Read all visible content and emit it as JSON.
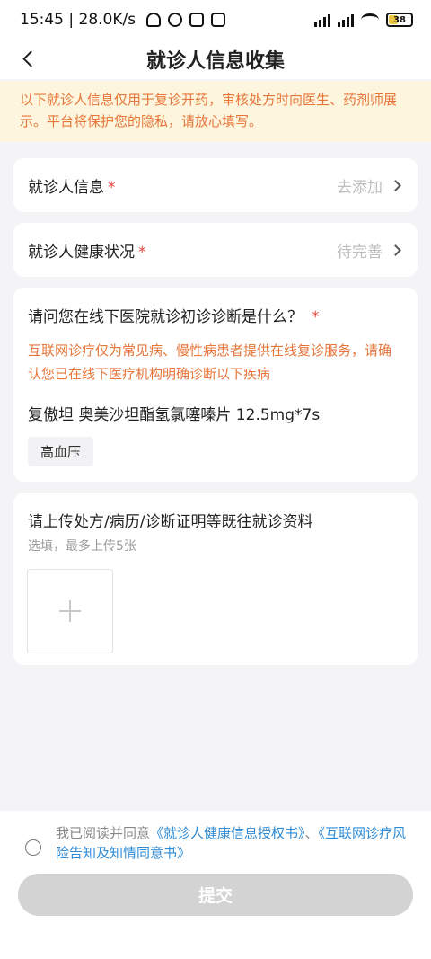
{
  "status_bar": {
    "time_speed": "15:45 | 28.0K/s",
    "battery": "38",
    "icons": [
      "bell-muted-icon",
      "alarm-icon",
      "nfc-icon",
      "tiktok-icon"
    ]
  },
  "nav": {
    "title": "就诊人信息收集"
  },
  "notice": {
    "text": "以下就诊人信息仅用于复诊开药，审核处方时向医生、药剂师展示。平台将保护您的隐私，请放心填写。"
  },
  "patient_info": {
    "label": "就诊人信息",
    "required_mark": "*",
    "value": "去添加"
  },
  "health_status": {
    "label": "就诊人健康状况",
    "required_mark": "*",
    "value": "待完善"
  },
  "diagnosis": {
    "question": "请问您在线下医院就诊初诊诊断是什么？",
    "required_mark": "*",
    "warning": "互联网诊疗仅为常见病、慢性病患者提供在线复诊服务，请确认您已在线下医疗机构明确诊断以下疾病",
    "drug": "复傲坦 奥美沙坦酯氢氯噻嗪片 12.5mg*7s",
    "tag": "高血压"
  },
  "upload": {
    "title": "请上传处方/病历/诊断证明等既往就诊资料",
    "hint": "选填，最多上传5张"
  },
  "agreement": {
    "prefix": "我已阅读并同意",
    "link1": "《就诊人健康信息授权书》",
    "separator": "、",
    "link2": "《互联网诊疗风险告知及知情同意书》"
  },
  "submit": {
    "label": "提交"
  },
  "colors": {
    "accent_orange": "#e6763a",
    "required_red": "#e8473a",
    "link_blue": "#2e8bd6",
    "notice_bg": "#fdf5dd",
    "button_disabled": "#d3d3d3"
  }
}
